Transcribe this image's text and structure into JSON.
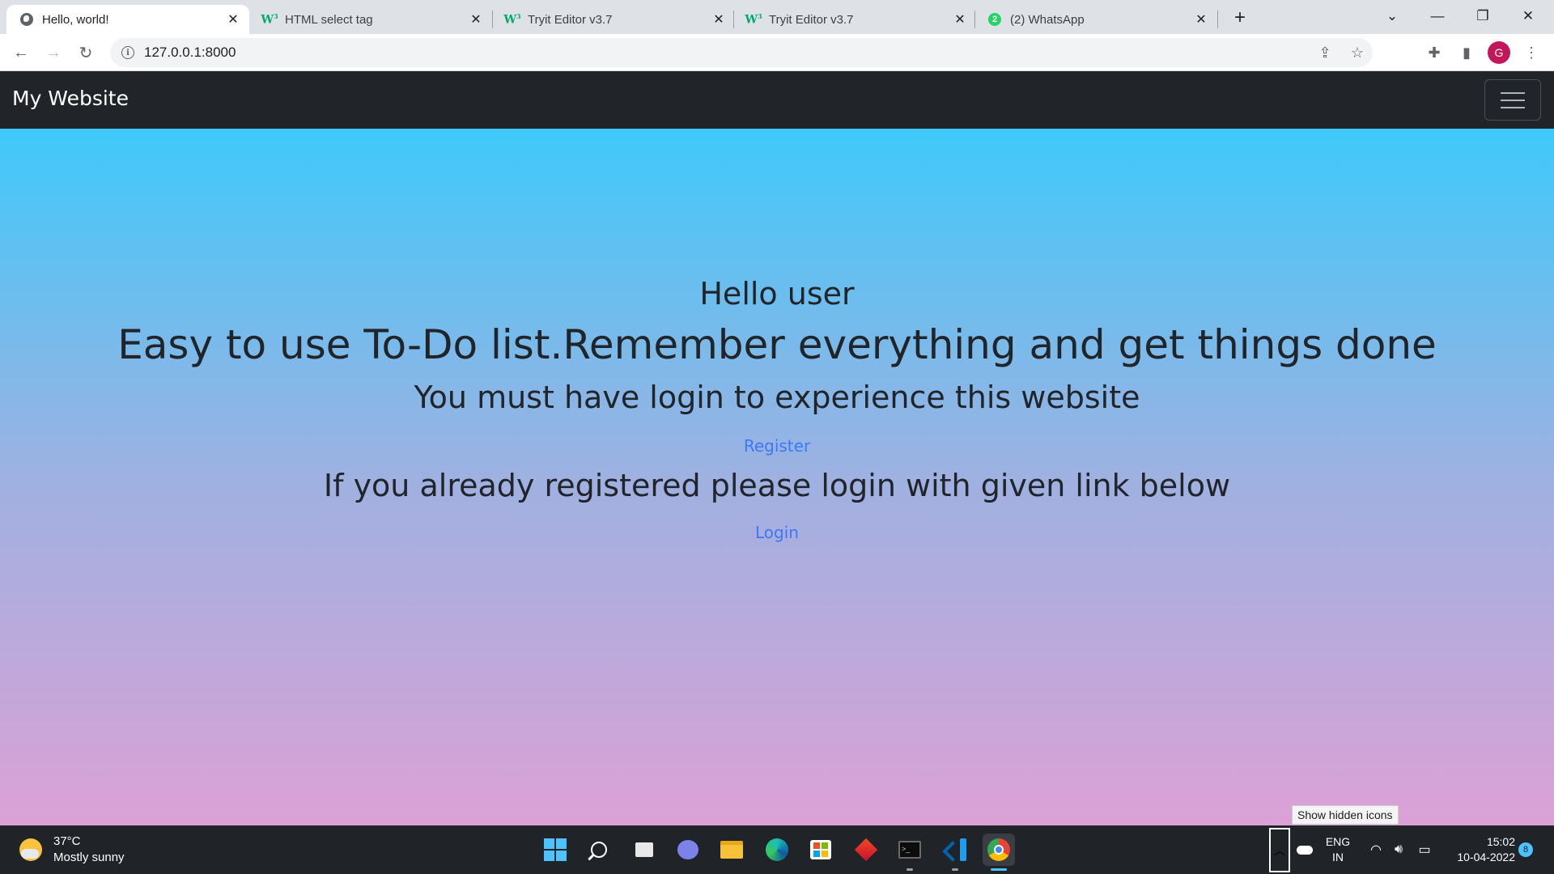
{
  "browser": {
    "tabs": [
      {
        "title": "Hello, world!",
        "favicon": "globe-icon",
        "active": true
      },
      {
        "title": "HTML select tag",
        "favicon": "w3schools-icon",
        "active": false
      },
      {
        "title": "Tryit Editor v3.7",
        "favicon": "w3schools-icon",
        "active": false
      },
      {
        "title": "Tryit Editor v3.7",
        "favicon": "w3schools-icon",
        "active": false
      },
      {
        "title": "(2) WhatsApp",
        "favicon": "whatsapp-icon",
        "badge": "2",
        "active": false
      }
    ],
    "url": "127.0.0.1:8000",
    "profile_initial": "G",
    "favicon_glyphs": {
      "w3": "W",
      "w3_sup": "3"
    }
  },
  "site": {
    "brand": "My Website",
    "hero": {
      "greeting": "Hello user",
      "headline": "Easy to use To-Do list.Remember everything and get things done",
      "notice": "You must have login to experience this website",
      "register_link": "Register",
      "already": "If you already registered please login with given link below",
      "login_link": "Login"
    }
  },
  "taskbar": {
    "weather": {
      "temp": "37°C",
      "condition": "Mostly sunny"
    },
    "apps": [
      "start",
      "search",
      "task-view",
      "chat",
      "file-explorer",
      "edge",
      "store",
      "git-app",
      "terminal",
      "vscode",
      "chrome"
    ],
    "terminal_glyph": ">_",
    "tooltip": "Show hidden icons",
    "language": {
      "line1": "ENG",
      "line2": "IN"
    },
    "time": "15:02",
    "date": "10-04-2022",
    "notifications": "8"
  },
  "colors": {
    "navbar": "#212529",
    "link": "#3d78f5",
    "gradient_top": "#3ec9fa",
    "gradient_bottom": "#dca1d6"
  }
}
